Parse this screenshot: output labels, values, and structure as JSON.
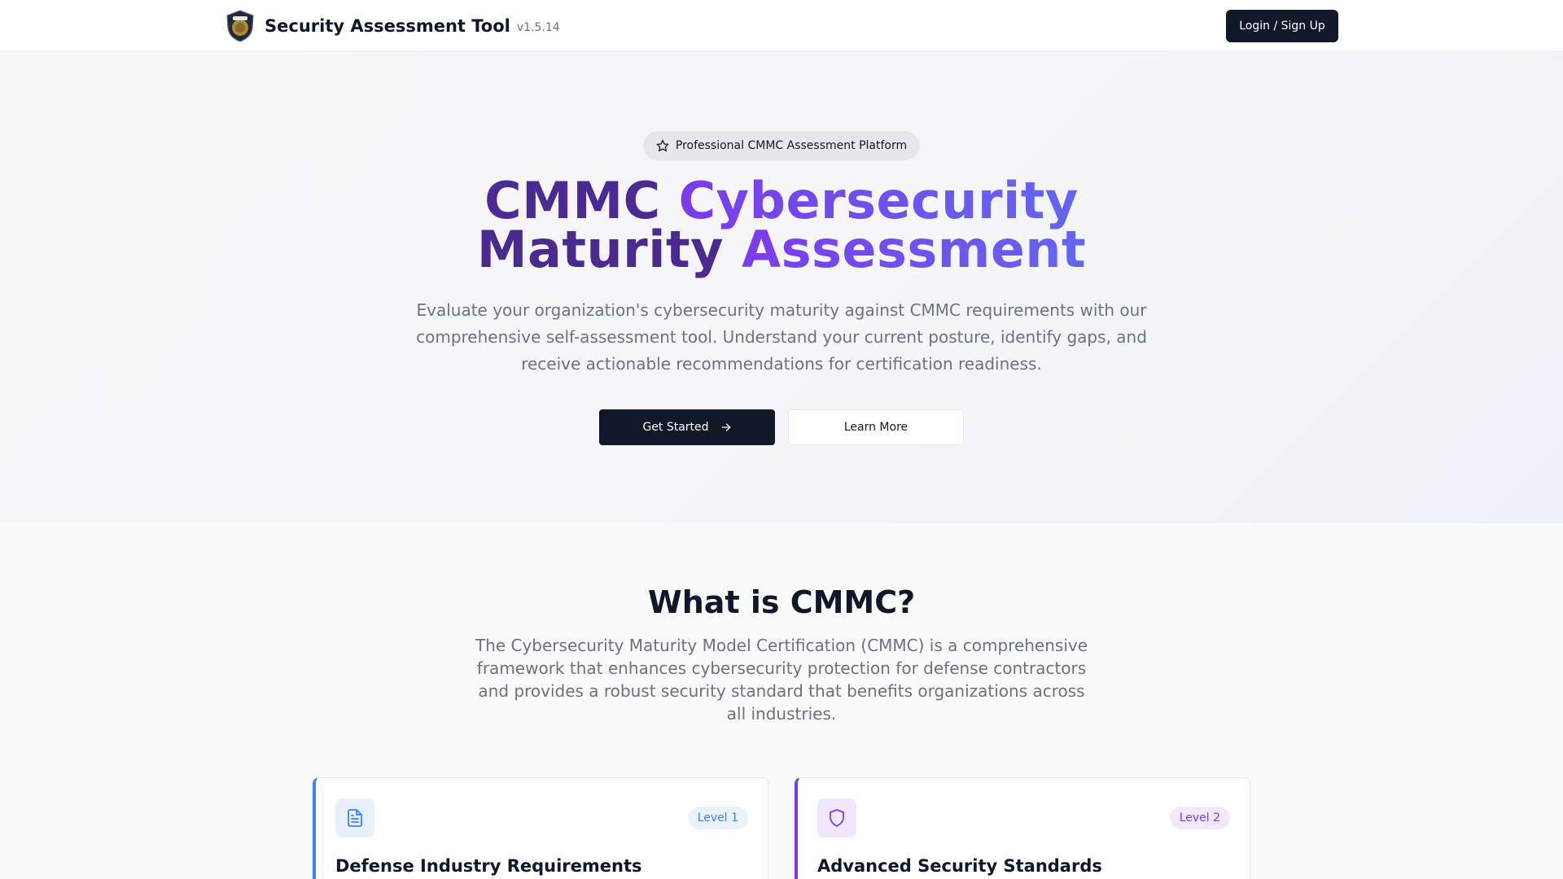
{
  "header": {
    "title": "Security Assessment Tool",
    "version": "v1.5.14",
    "login_label": "Login / Sign Up"
  },
  "hero": {
    "badge": "Professional CMMC Assessment Platform",
    "badge_icon": "star-icon",
    "title_word1": "CMMC",
    "title_word2": "Cybersecurity",
    "title_word3": "Maturity",
    "title_word4": "Assessment",
    "description": "Evaluate your organization's cybersecurity maturity against CMMC requirements with our comprehensive self-assessment tool. Understand your current posture, identify gaps, and receive actionable recommendations for certification readiness.",
    "primary_button": "Get Started",
    "secondary_button": "Learn More"
  },
  "about": {
    "title": "What is CMMC?",
    "description": "The Cybersecurity Maturity Model Certification (CMMC) is a comprehensive framework that enhances cybersecurity protection for defense contractors and provides a robust security standard that benefits organizations across all industries."
  },
  "cards": [
    {
      "level": "Level 1",
      "title": "Defense Industry Requirements",
      "icon": "document-icon",
      "accent": "#3b82f6"
    },
    {
      "level": "Level 2",
      "title": "Advanced Security Standards",
      "icon": "shield-icon",
      "accent": "#7c3aed"
    }
  ]
}
